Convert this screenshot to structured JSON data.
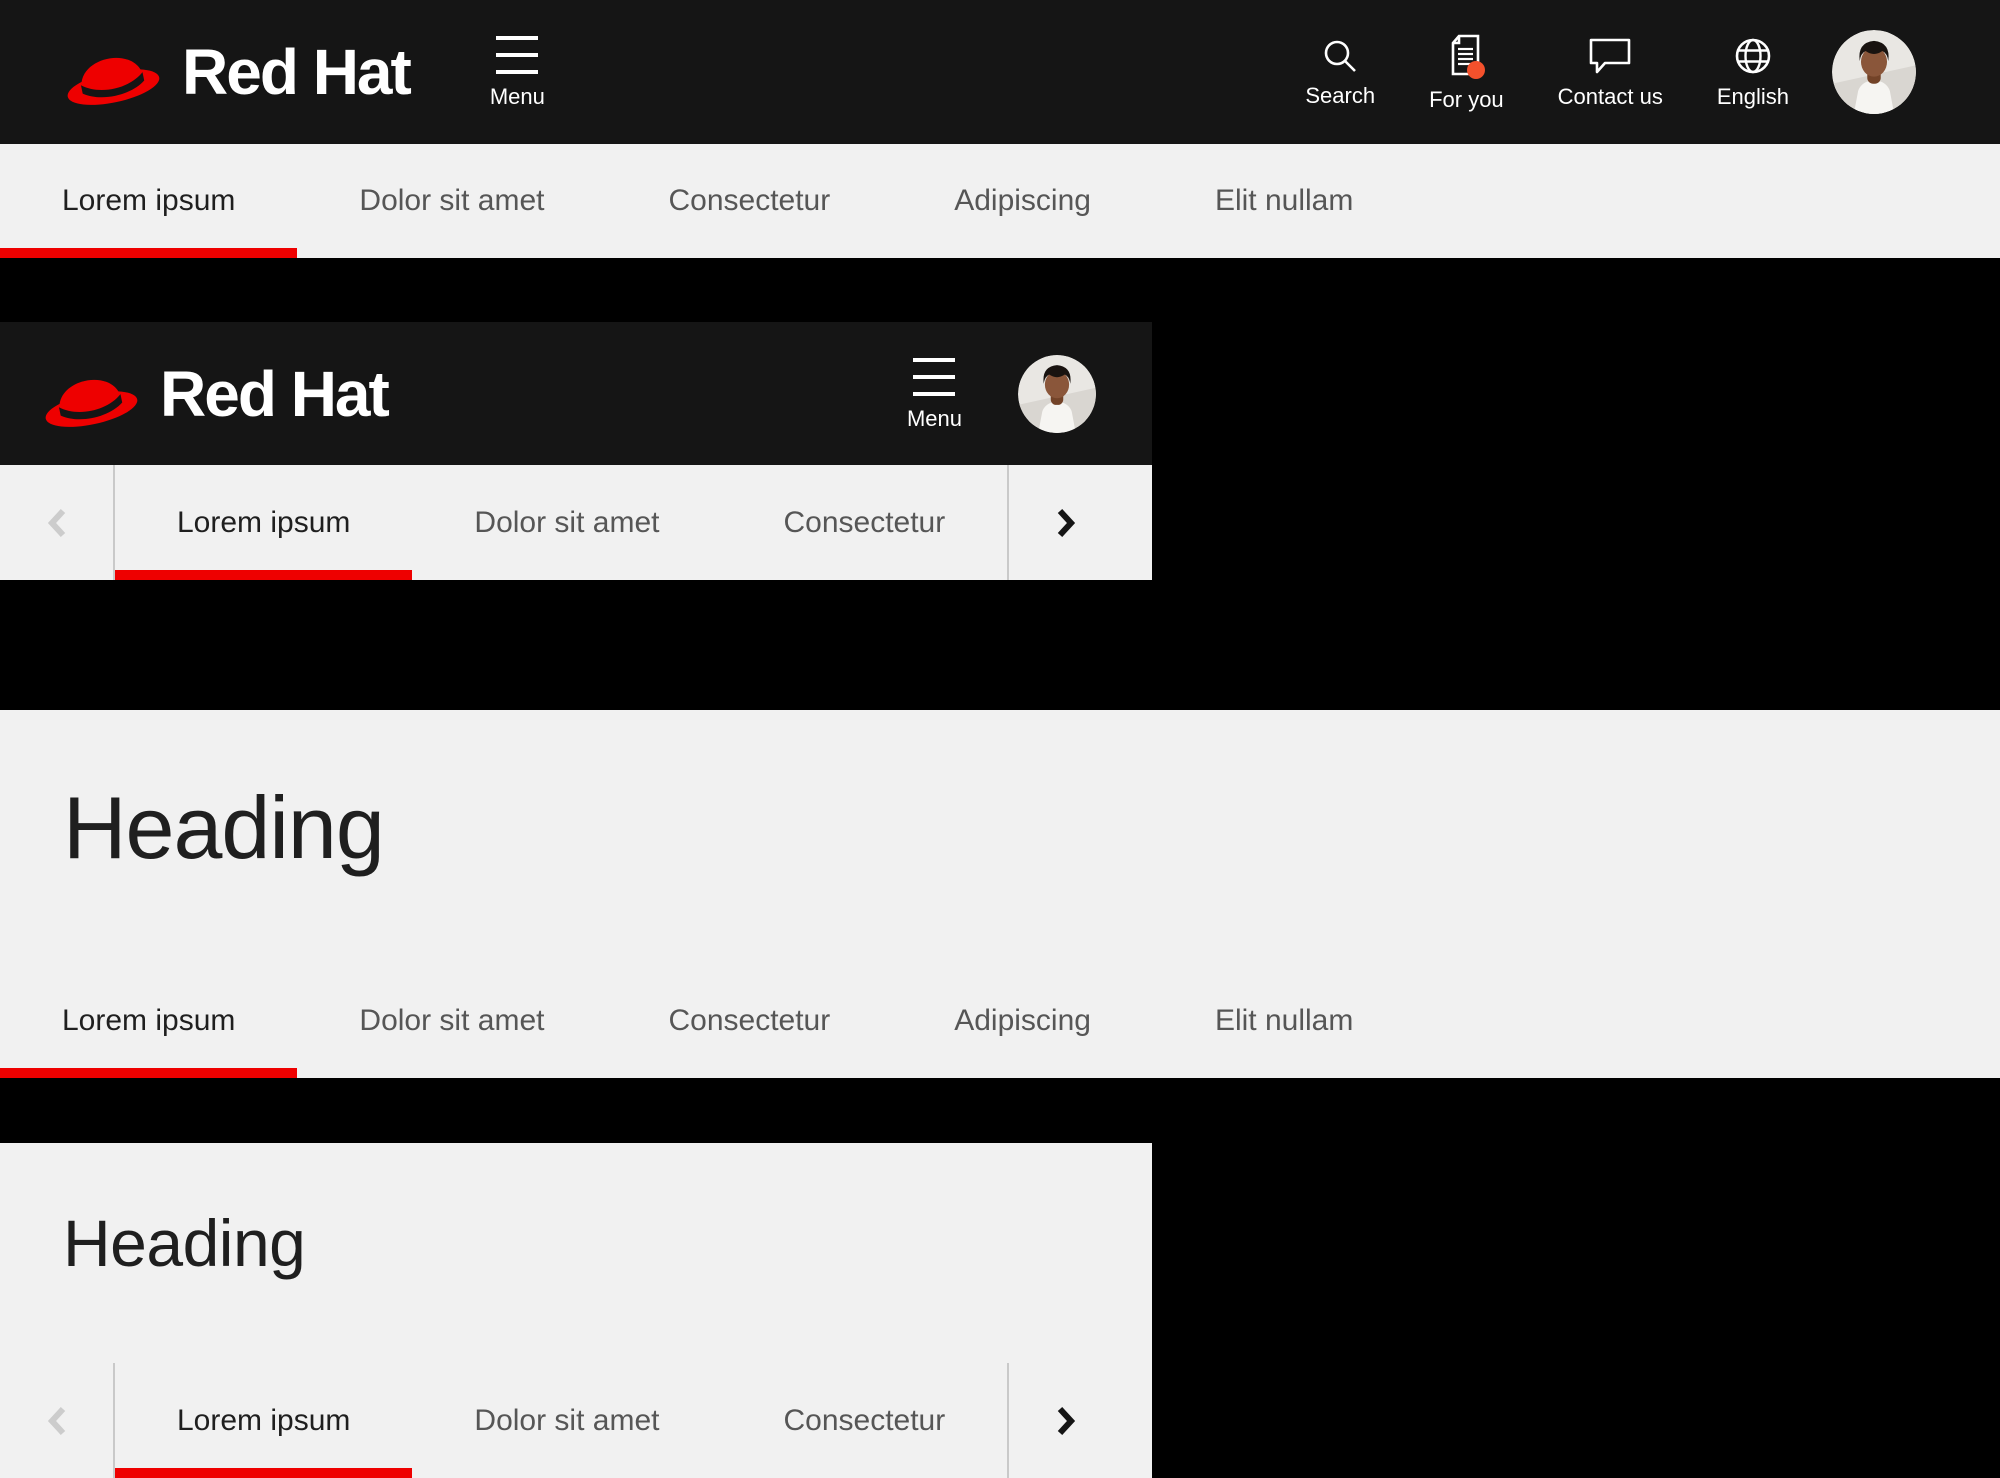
{
  "colors": {
    "header_bg": "#151515",
    "page_bg": "#000000",
    "surface": "#f1f1f1",
    "brand_red": "#ee0000",
    "active_tab_underline": "#ee0000",
    "notification_dot": "#f4512c",
    "tab_active_text": "#1f1f1f",
    "tab_inactive_text": "#565656",
    "divider": "#c9c9c9",
    "chevron_disabled": "#cccccc",
    "chevron_enabled": "#151515",
    "header_text": "#ffffff"
  },
  "brand": {
    "wordmark": "Red Hat"
  },
  "desktop_header": {
    "menu_label": "Menu",
    "actions": [
      {
        "label": "Search",
        "icon": "search-icon"
      },
      {
        "label": "For you",
        "icon": "document-icon",
        "has_notification_dot": true
      },
      {
        "label": "Contact us",
        "icon": "chat-bubble-icon"
      },
      {
        "label": "English",
        "icon": "globe-icon"
      }
    ],
    "avatar": "user-avatar-photo"
  },
  "mobile_header": {
    "wordmark": "Red Hat",
    "menu_label": "Menu",
    "avatar": "user-avatar-photo"
  },
  "desktop_tabs": {
    "active_index": 0,
    "items": [
      "Lorem ipsum",
      "Dolor sit amet",
      "Consectetur",
      "Adipiscing",
      "Elit nullam"
    ]
  },
  "mobile_tabs": {
    "active_index": 0,
    "items": [
      "Lorem ipsum",
      "Dolor sit amet",
      "Consectetur"
    ],
    "prev_chevron_disabled": true,
    "next_chevron_enabled": true
  },
  "desktop_tab_section": {
    "heading": "Heading"
  },
  "mobile_tab_section": {
    "heading": "Heading"
  }
}
